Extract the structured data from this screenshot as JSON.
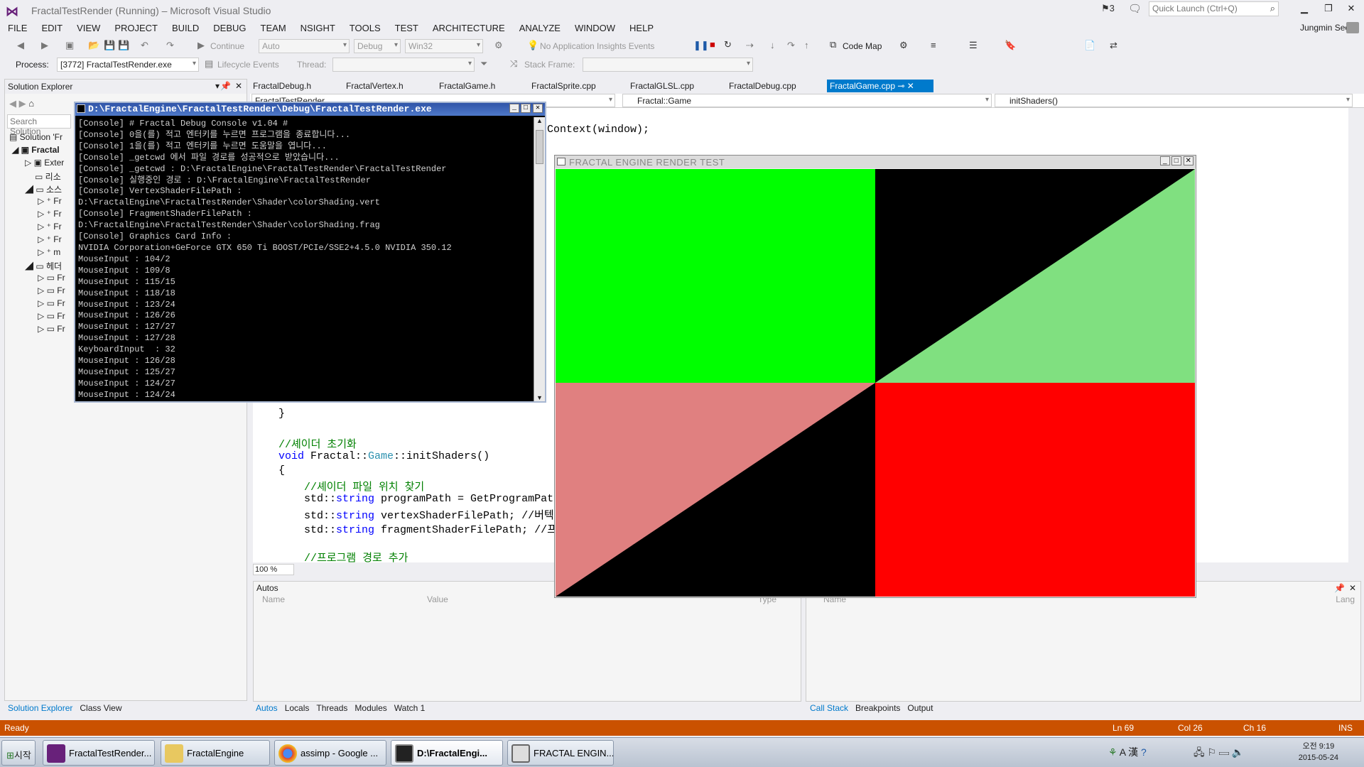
{
  "window": {
    "title": "FractalTestRender (Running) – Microsoft Visual Studio",
    "notif": "3",
    "quick_launch": "Quick Launch (Ctrl+Q)",
    "user": "Jungmin Seo"
  },
  "menu": [
    "FILE",
    "EDIT",
    "VIEW",
    "PROJECT",
    "BUILD",
    "DEBUG",
    "TEAM",
    "NSIGHT",
    "TOOLS",
    "TEST",
    "ARCHITECTURE",
    "ANALYZE",
    "WINDOW",
    "HELP"
  ],
  "toolbar": {
    "continue": "Continue",
    "config_auto": "Auto",
    "config_debug": "Debug",
    "platform": "Win32",
    "insights": "No Application Insights Events",
    "code_map": "Code Map",
    "process_label": "Process:",
    "process_value": "[3772] FractalTestRender.exe",
    "lifecycle": "Lifecycle Events",
    "thread": "Thread:",
    "stack_frame": "Stack Frame:"
  },
  "solution": {
    "title": "Solution Explorer",
    "search": "Search Solution",
    "items": [
      "Solution 'Fr",
      "Fractal",
      "Exter",
      "리소",
      "소스",
      "Fr",
      "Fr",
      "Fr",
      "Fr",
      "m",
      "헤더",
      "Fr",
      "Fr",
      "Fr",
      "Fr",
      "Fr"
    ],
    "tab_se": "Solution Explorer",
    "tab_cv": "Class View"
  },
  "editor": {
    "tabs": [
      "FractalDebug.h",
      "FractalVertex.h",
      "FractalGame.h",
      "FractalSprite.cpp",
      "FractalGLSL.cpp",
      "FractalDebug.cpp",
      "FractalGame.cpp"
    ],
    "nav1": "FractalTestRender",
    "nav2": "Fractal::Game",
    "nav3": "initShaders()",
    "zoom": "100 %"
  },
  "code": {
    "l_ctx": "Context(window);",
    "l_brace_close": "}",
    "l_cm1": "//셰이더 초기화",
    "l_void": "void",
    "l_fn_a": " Fractal::",
    "l_game": "Game",
    "l_fn_b": "::initShaders()",
    "l_brace_open": "{",
    "l_cm2": "//셰이더 파일 위치 찾기",
    "l_std": "std::",
    "l_string": "string",
    "l_s1": " programPath = GetProgramPat",
    "l_s2": " vertexShaderFilePath; //버텍",
    "l_s3": " fragmentShaderFilePath; //프",
    "l_cm3": "//프로그램 경로 추가"
  },
  "console": {
    "title": "D:\\FractalEngine\\FractalTestRender\\Debug\\FractalTestRender.exe",
    "lines": [
      "[Console] # Fractal Debug Console v1.04 #",
      "[Console] 0을(를) 적고 엔터키를 누르면 프로그램을 종료합니다...",
      "[Console] 1을(를) 적고 엔터키를 누르면 도움말을 엽니다...",
      "[Console] _getcwd 에서 파일 경로를 성공적으로 받았습니다...",
      "[Console] _getcwd : D:\\FractalEngine\\FractalTestRender\\FractalTestRender",
      "[Console] 실행중인 경로 : D:\\FractalEngine\\FractalTestRender",
      "[Console] VertexShaderFilePath :",
      "D:\\FractalEngine\\FractalTestRender\\Shader\\colorShading.vert",
      "[Console] FragmentShaderFilePath :",
      "D:\\FractalEngine\\FractalTestRender\\Shader\\colorShading.frag",
      "[Console] Graphics Card Info :",
      "NVIDIA Corporation+GeForce GTX 650 Ti BOOST/PCIe/SSE2+4.5.0 NVIDIA 350.12",
      "MouseInput : 104/2",
      "MouseInput : 109/8",
      "MouseInput : 115/15",
      "MouseInput : 118/18",
      "MouseInput : 123/24",
      "MouseInput : 126/26",
      "MouseInput : 127/27",
      "MouseInput : 127/28",
      "KeyboardInput  : 32",
      "MouseInput : 126/28",
      "MouseInput : 125/27",
      "MouseInput : 124/27",
      "MouseInput : 124/24"
    ]
  },
  "render": {
    "title": "FRACTAL ENGINE RENDER TEST",
    "colors": {
      "green": "#00ff00",
      "light_green": "#80e080",
      "pink": "#e08080",
      "red": "#ff0000",
      "black": "#000000"
    }
  },
  "autos": {
    "title": "Autos",
    "col_name": "Name",
    "col_value": "Value",
    "col_type": "Type",
    "tabs": [
      "Autos",
      "Locals",
      "Threads",
      "Modules",
      "Watch 1"
    ]
  },
  "callstack": {
    "col_name": "Name",
    "col_lang": "Lang",
    "tabs": [
      "Call Stack",
      "Breakpoints",
      "Output"
    ]
  },
  "status": {
    "ready": "Ready",
    "ln": "Ln 69",
    "col": "Col 26",
    "ch": "Ch 16",
    "ins": "INS"
  },
  "taskbar": {
    "start": "시작",
    "items": [
      "FractalTestRender...",
      "FractalEngine",
      "assimp - Google ...",
      "D:\\FractalEngi...",
      "FRACTAL ENGIN..."
    ],
    "time": "오전 9:19",
    "date": "2015-05-24",
    "ime1": "A",
    "ime2": "漢"
  }
}
